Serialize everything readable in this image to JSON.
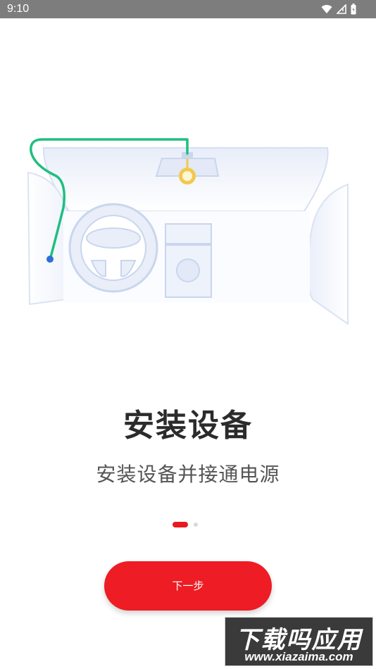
{
  "status_bar": {
    "time": "9:10",
    "icons": [
      "wifi-icon",
      "signal-icon",
      "battery-icon"
    ]
  },
  "illustration": {
    "name": "car-dashcam-illustration",
    "cable_color": "#1fbf7f",
    "camera_color": "#f2c94c",
    "line_color": "#c9d6ee"
  },
  "guide": {
    "title": "安装设备",
    "subtitle": "安装设备并接通电源"
  },
  "pager": {
    "total": 2,
    "current": 1,
    "active_color": "#e8191f"
  },
  "actions": {
    "next_label": "下一步",
    "accent": "#ee1c24"
  },
  "watermark": {
    "line1": "下载吗应用",
    "line2": "www.xiazaima.com"
  }
}
